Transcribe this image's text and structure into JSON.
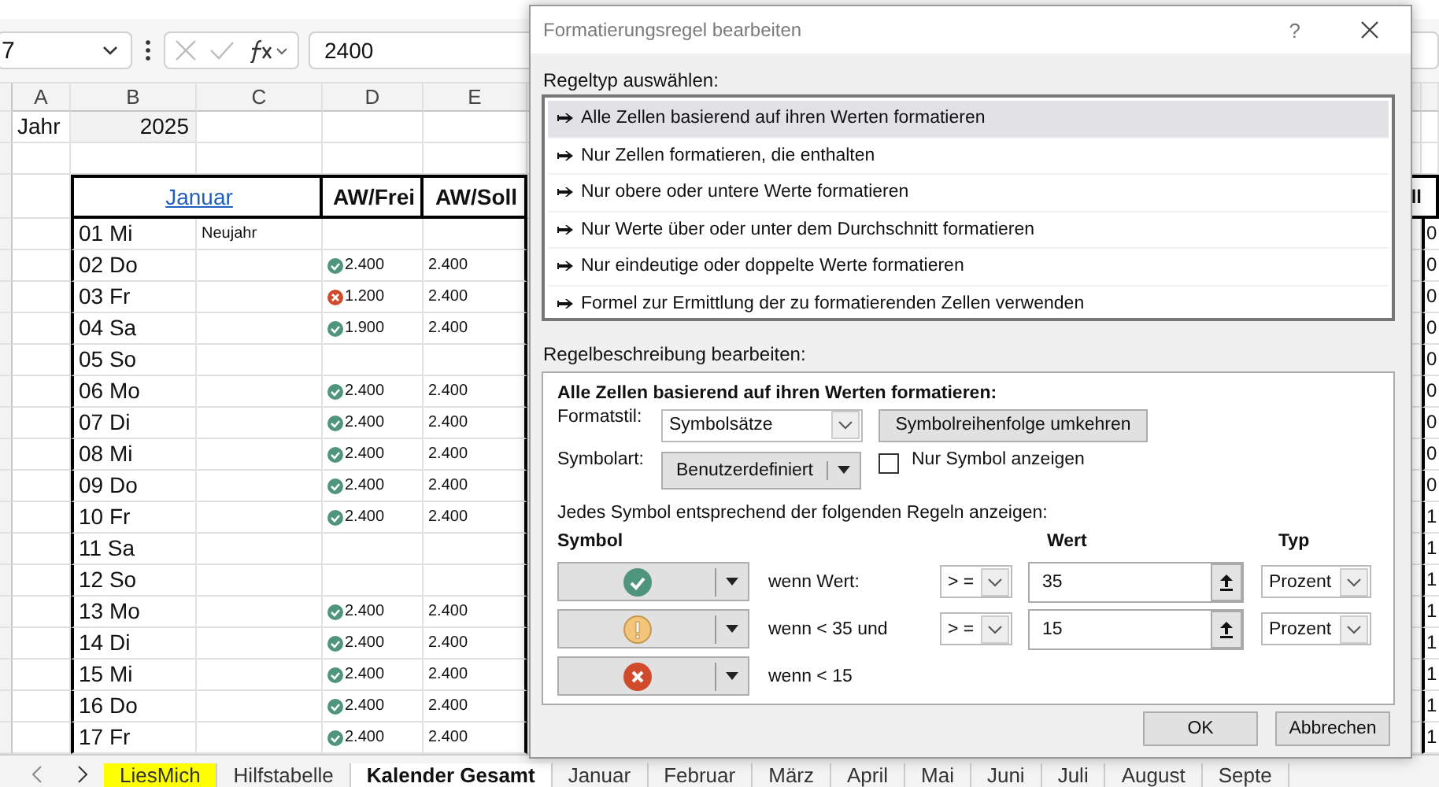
{
  "formula_bar": {
    "name_box": "7",
    "formula": "2400"
  },
  "sheet": {
    "columns": [
      "A",
      "B",
      "C",
      "D",
      "E"
    ],
    "year_label": "Jahr",
    "year": "2025",
    "month": "Januar",
    "headers": [
      "AW/Frei",
      "AW/Soll"
    ],
    "edge_header": "ll",
    "rows": [
      {
        "day": "01 Mi",
        "note": "Neujahr",
        "frei": "",
        "soll": "",
        "edge": "0"
      },
      {
        "day": "02 Do",
        "kind": "check",
        "frei": "2.400",
        "soll": "2.400",
        "edge": "0"
      },
      {
        "day": "03 Fr",
        "kind": "cross",
        "frei": "1.200",
        "soll": "2.400",
        "edge": "0"
      },
      {
        "day": "04 Sa",
        "kind": "check",
        "frei": "1.900",
        "soll": "2.400",
        "edge": "0"
      },
      {
        "day": "05 So",
        "frei": "",
        "soll": "",
        "edge": "0"
      },
      {
        "day": "06 Mo",
        "kind": "check",
        "frei": "2.400",
        "soll": "2.400",
        "edge": "0"
      },
      {
        "day": "07 Di",
        "kind": "check",
        "frei": "2.400",
        "soll": "2.400",
        "edge": "0"
      },
      {
        "day": "08 Mi",
        "kind": "check",
        "frei": "2.400",
        "soll": "2.400",
        "edge": "0"
      },
      {
        "day": "09 Do",
        "kind": "check",
        "frei": "2.400",
        "soll": "2.400",
        "edge": "0"
      },
      {
        "day": "10 Fr",
        "kind": "check",
        "frei": "2.400",
        "soll": "2.400",
        "edge": "1"
      },
      {
        "day": "11 Sa",
        "frei": "",
        "soll": "",
        "edge": "1"
      },
      {
        "day": "12 So",
        "frei": "",
        "soll": "",
        "edge": "1"
      },
      {
        "day": "13 Mo",
        "kind": "check",
        "frei": "2.400",
        "soll": "2.400",
        "edge": "1"
      },
      {
        "day": "14 Di",
        "kind": "check",
        "frei": "2.400",
        "soll": "2.400",
        "edge": "1"
      },
      {
        "day": "15 Mi",
        "kind": "check",
        "frei": "2.400",
        "soll": "2.400",
        "edge": "1"
      },
      {
        "day": "16 Do",
        "kind": "check",
        "frei": "2.400",
        "soll": "2.400",
        "edge": "1"
      },
      {
        "day": "17 Fr",
        "kind": "check",
        "frei": "2.400",
        "soll": "2.400",
        "edge": "1"
      }
    ]
  },
  "sheet_tabs": [
    {
      "label": "LiesMich",
      "selected": false,
      "color": "#ffff00"
    },
    {
      "label": "Hilfstabelle",
      "selected": false
    },
    {
      "label": "Kalender Gesamt",
      "selected": true
    },
    {
      "label": "Januar",
      "selected": false
    },
    {
      "label": "Februar",
      "selected": false
    },
    {
      "label": "März",
      "selected": false
    },
    {
      "label": "April",
      "selected": false
    },
    {
      "label": "Mai",
      "selected": false
    },
    {
      "label": "Juni",
      "selected": false
    },
    {
      "label": "Juli",
      "selected": false
    },
    {
      "label": "August",
      "selected": false
    },
    {
      "label": "Septe",
      "selected": false
    }
  ],
  "dialog": {
    "title": "Formatierungsregel bearbeiten",
    "help": "?",
    "rule_type_label": "Regeltyp auswählen:",
    "rule_types": [
      {
        "label": "Alle Zellen basierend auf ihren Werten formatieren",
        "selected": true
      },
      {
        "label": "Nur Zellen formatieren, die enthalten",
        "selected": false
      },
      {
        "label": "Nur obere oder untere Werte formatieren",
        "selected": false
      },
      {
        "label": "Nur Werte über oder unter dem Durchschnitt formatieren",
        "selected": false
      },
      {
        "label": "Nur eindeutige oder doppelte Werte formatieren",
        "selected": false
      },
      {
        "label": "Formel zur Ermittlung der zu formatierenden Zellen verwenden",
        "selected": false
      }
    ],
    "description_label": "Regelbeschreibung bearbeiten:",
    "description_heading": "Alle Zellen basierend auf ihren Werten formatieren:",
    "format_style_label": "Formatstil:",
    "format_style": "Symbolsätze",
    "reverse_button": "Symbolreihenfolge umkehren",
    "icon_style_label": "Symbolart:",
    "icon_style": "Benutzerdefiniert",
    "icon_only": {
      "label": "Nur Symbol anzeigen",
      "checked": false
    },
    "instructions": "Jedes Symbol entsprechend der folgenden Regeln anzeigen:",
    "column_heads": [
      "Symbol",
      "Wert",
      "Typ"
    ],
    "rules": [
      {
        "kind": "check",
        "condition": "wenn Wert:",
        "operator": "> =",
        "value": "35",
        "type": "Prozent"
      },
      {
        "kind": "warning",
        "condition": "wenn < 35 und",
        "operator": "> =",
        "value": "15",
        "type": "Prozent"
      },
      {
        "kind": "cross",
        "condition": "wenn < 15"
      }
    ],
    "buttons": [
      "OK",
      "Abbrechen"
    ]
  }
}
